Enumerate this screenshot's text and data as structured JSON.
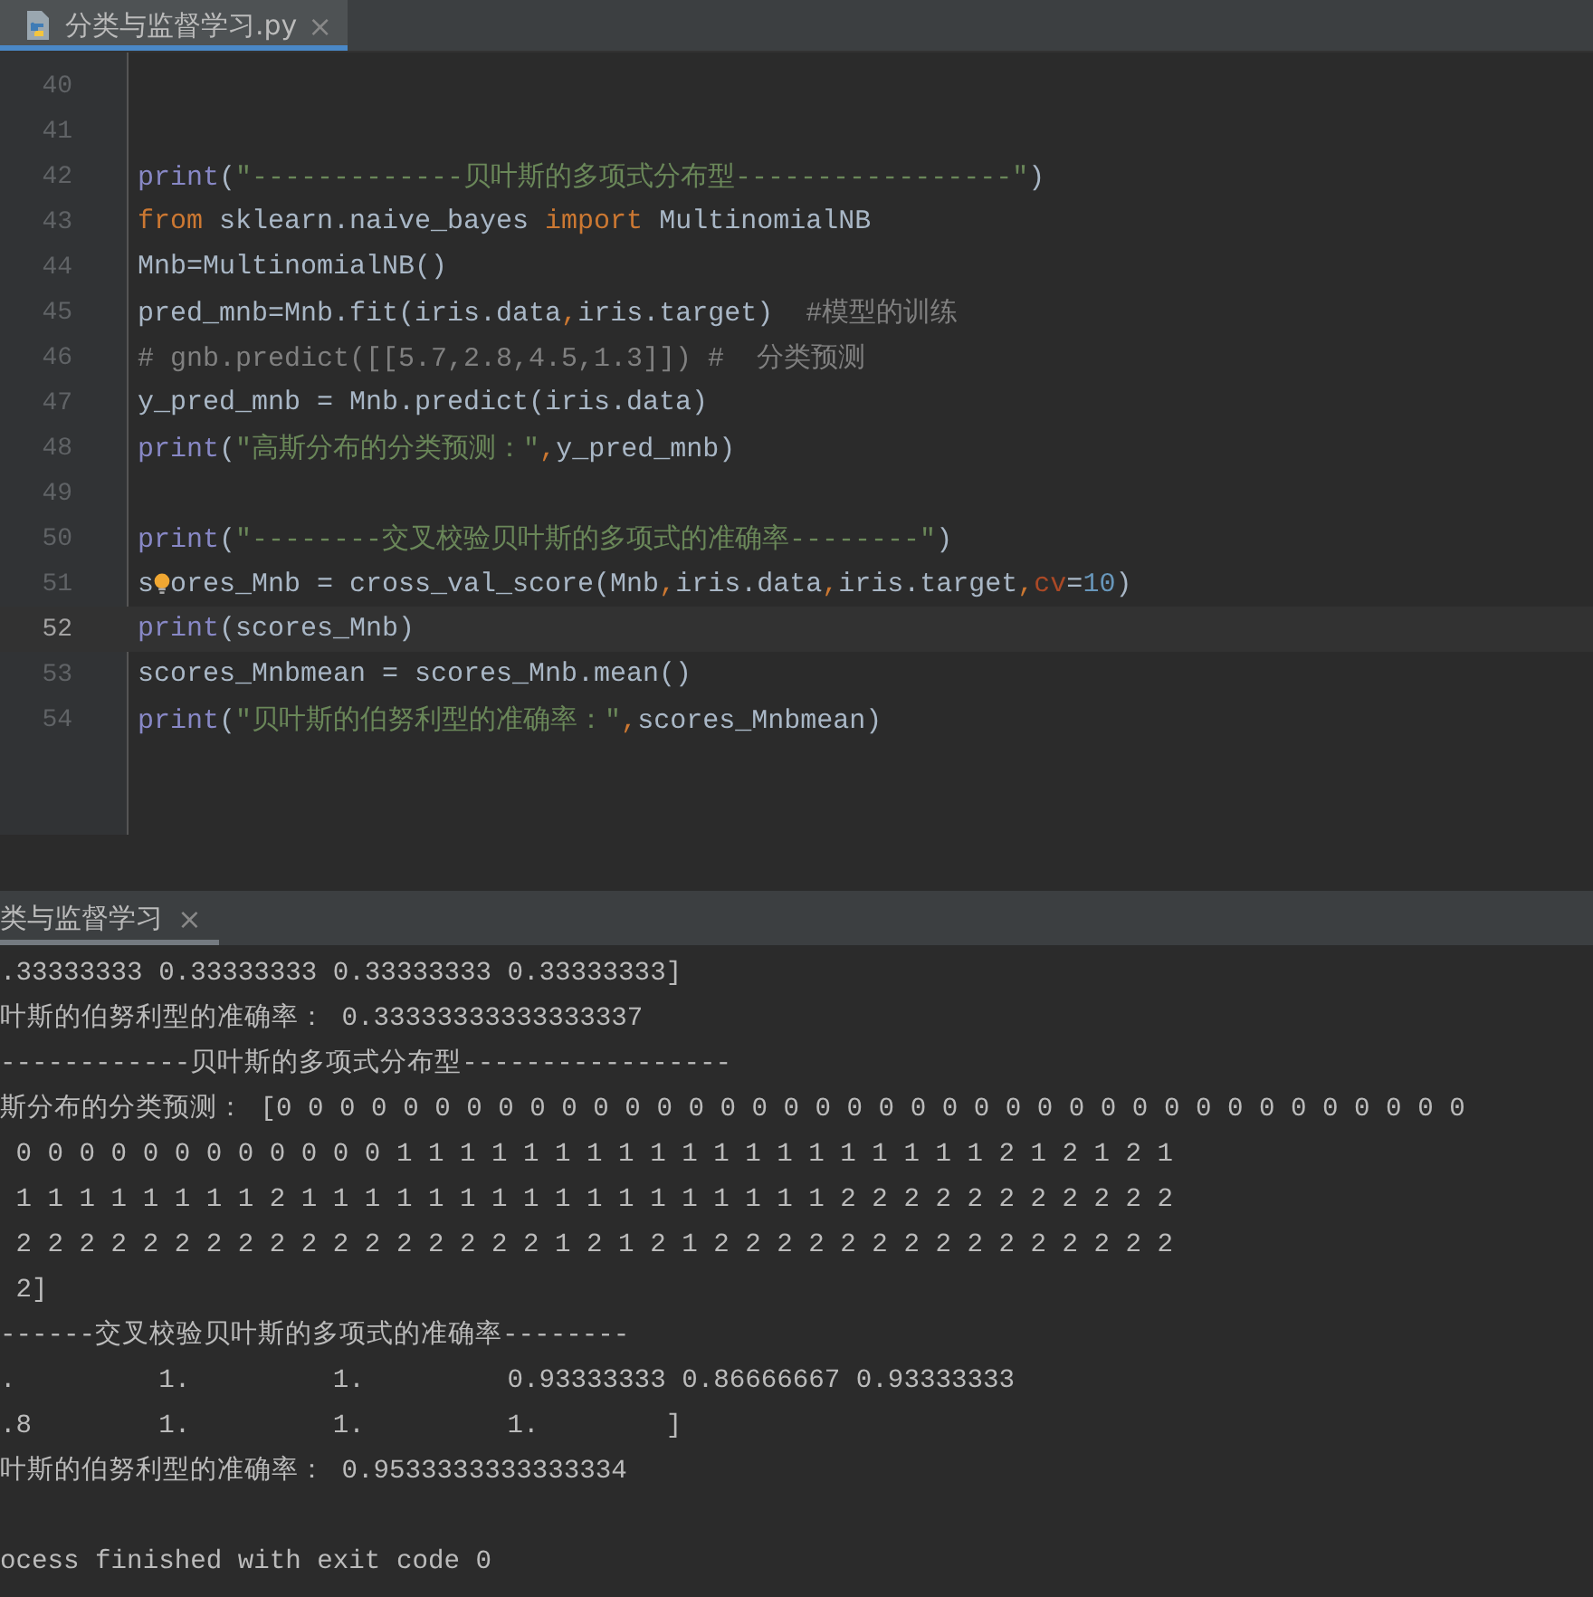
{
  "editor_tab": {
    "label": "分类与监督学习.py",
    "close": "×",
    "selected": true
  },
  "code_lines": [
    {
      "number": "40",
      "current": false
    },
    {
      "number": "41",
      "current": false
    },
    {
      "number": "42",
      "current": false,
      "tokens": [
        {
          "t": "print",
          "kind": "builtin"
        },
        {
          "t": "(",
          "kind": "plain"
        },
        {
          "t": "\"-------------贝叶斯的多项式分布型-----------------\"",
          "kind": "string"
        },
        {
          "t": ")",
          "kind": "plain"
        }
      ]
    },
    {
      "number": "43",
      "current": false,
      "tokens": [
        {
          "t": "from",
          "kind": "keyword"
        },
        {
          "t": " sklearn.naive_bayes ",
          "kind": "plain"
        },
        {
          "t": "import",
          "kind": "keyword"
        },
        {
          "t": " MultinomialNB",
          "kind": "plain"
        }
      ]
    },
    {
      "number": "44",
      "current": false,
      "tokens": [
        {
          "t": "Mnb=MultinomialNB()",
          "kind": "plain"
        }
      ]
    },
    {
      "number": "45",
      "current": false,
      "tokens": [
        {
          "t": "pred_mnb=Mnb.fit(iris.data",
          "kind": "plain"
        },
        {
          "t": ",",
          "kind": "keyword"
        },
        {
          "t": "iris.target)  ",
          "kind": "plain"
        },
        {
          "t": "#模型的训练",
          "kind": "comment"
        }
      ]
    },
    {
      "number": "46",
      "current": false,
      "tokens": [
        {
          "t": "# gnb.predict([[5.7,2.8,4.5,1.3]]) #  分类预测",
          "kind": "comment"
        }
      ]
    },
    {
      "number": "47",
      "current": false,
      "tokens": [
        {
          "t": "y_pred_mnb = Mnb.predict(iris.data)",
          "kind": "plain"
        }
      ]
    },
    {
      "number": "48",
      "current": false,
      "tokens": [
        {
          "t": "print",
          "kind": "builtin"
        },
        {
          "t": "(",
          "kind": "plain"
        },
        {
          "t": "\"高斯分布的分类预测：\"",
          "kind": "string"
        },
        {
          "t": ",",
          "kind": "keyword"
        },
        {
          "t": "y_pred_mnb)",
          "kind": "plain"
        }
      ]
    },
    {
      "number": "49",
      "current": false
    },
    {
      "number": "50",
      "current": false,
      "tokens": [
        {
          "t": "print",
          "kind": "builtin"
        },
        {
          "t": "(",
          "kind": "plain"
        },
        {
          "t": "\"--------交叉校验贝叶斯的多项式的准确率--------\"",
          "kind": "string"
        },
        {
          "t": ")",
          "kind": "plain"
        }
      ]
    },
    {
      "number": "51",
      "current": false,
      "tokens": [
        {
          "t": "s",
          "kind": "plain"
        },
        {
          "kind": "lightbulb"
        },
        {
          "t": "ores_Mnb = cross_val_score(Mnb",
          "kind": "plain"
        },
        {
          "t": ",",
          "kind": "keyword"
        },
        {
          "t": "iris.data",
          "kind": "plain"
        },
        {
          "t": ",",
          "kind": "keyword"
        },
        {
          "t": "iris.target",
          "kind": "plain"
        },
        {
          "t": ",",
          "kind": "keyword"
        },
        {
          "t": "cv",
          "kind": "param"
        },
        {
          "t": "=",
          "kind": "plain"
        },
        {
          "t": "10",
          "kind": "number"
        },
        {
          "t": ")",
          "kind": "plain"
        }
      ]
    },
    {
      "number": "52",
      "current": true,
      "tokens": [
        {
          "t": "print",
          "kind": "builtin"
        },
        {
          "t": "(scores_Mnb)",
          "kind": "plain"
        }
      ]
    },
    {
      "number": "53",
      "current": false,
      "tokens": [
        {
          "t": "scores_Mnbmean = scores_Mnb.mean()",
          "kind": "plain"
        }
      ]
    },
    {
      "number": "54",
      "current": false,
      "tokens": [
        {
          "t": "print",
          "kind": "builtin"
        },
        {
          "t": "(",
          "kind": "plain"
        },
        {
          "t": "\"贝叶斯的伯努利型的准确率：\"",
          "kind": "string"
        },
        {
          "t": ",",
          "kind": "keyword"
        },
        {
          "t": "scores_Mnbmean)",
          "kind": "plain"
        }
      ]
    }
  ],
  "run_tab": {
    "label": "类与监督学习",
    "close": "×",
    "selected": true
  },
  "console_blocks": [
    {
      "lines": [
        {
          "text": ".33333333 0.33333333 0.33333333 0.33333333]"
        },
        {
          "text": "叶斯的伯努利型的准确率： 0.33333333333333337"
        },
        {
          "text": "------------贝叶斯的多项式分布型-----------------"
        },
        {
          "text": "斯分布的分类预测： [0 0 0 0 0 0 0 0 0 0 0 0 0 0 0 0 0 0 0 0 0 0 0 0 0 0 0 0 0 0 0 0 0 0 0 0 0 0"
        },
        {
          "text": " 0 0 0 0 0 0 0 0 0 0 0 0 1 1 1 1 1 1 1 1 1 1 1 1 1 1 1 1 1 1 1 2 1 2 1 2 1"
        },
        {
          "text": " 1 1 1 1 1 1 1 1 2 1 1 1 1 1 1 1 1 1 1 1 1 1 1 1 1 1 2 2 2 2 2 2 2 2 2 2 2"
        },
        {
          "text": " 2 2 2 2 2 2 2 2 2 2 2 2 2 2 2 2 2 1 2 1 2 1 2 2 2 2 2 2 2 2 2 2 2 2 2 2 2"
        },
        {
          "text": " 2]"
        },
        {
          "text": "------交叉校验贝叶斯的多项式的准确率--------"
        },
        {
          "text": ".         1.         1.         0.93333333 0.86666667 0.93333333"
        },
        {
          "text": ".8        1.         1.         1.        ]"
        },
        {
          "text": "叶斯的伯努利型的准确率： 0.9533333333333334"
        }
      ]
    },
    {
      "lines": [
        {
          "text": "ocess finished with exit code 0"
        }
      ]
    }
  ]
}
